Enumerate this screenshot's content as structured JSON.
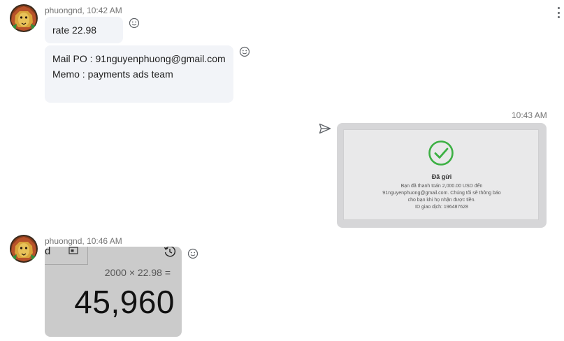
{
  "messages": [
    {
      "sender": "phuongnd",
      "time": "10:42 AM",
      "bubbles": [
        "rate 22.98",
        "Mail PO : 91nguyenphuong@gmail.com",
        "Memo : payments ads team"
      ]
    },
    {
      "time": "10:43 AM",
      "receipt": {
        "title": "Đã gửi",
        "lines": [
          "Bạn đã thanh toán 2,000.00 USD đến",
          "91nguyenphuong@gmail.com. Chúng tôi sẽ thông báo",
          "cho bạn khi họ nhận được tiền.",
          "ID giao dịch: 196487628"
        ]
      }
    },
    {
      "sender": "phuongnd",
      "time": "10:46 AM",
      "calculator": {
        "partial_text": "d",
        "expression": "2000 × 22.98 =",
        "result": "45,960"
      }
    }
  ],
  "colors": {
    "bubble": "#f2f4f8",
    "meta": "#757575",
    "success": "#3cb043"
  },
  "icons": {
    "emoji": "smiley-face-icon",
    "send": "paper-plane-icon",
    "more": "vertical-dots-icon",
    "check": "check-circle-icon",
    "history": "history-clock-icon"
  }
}
